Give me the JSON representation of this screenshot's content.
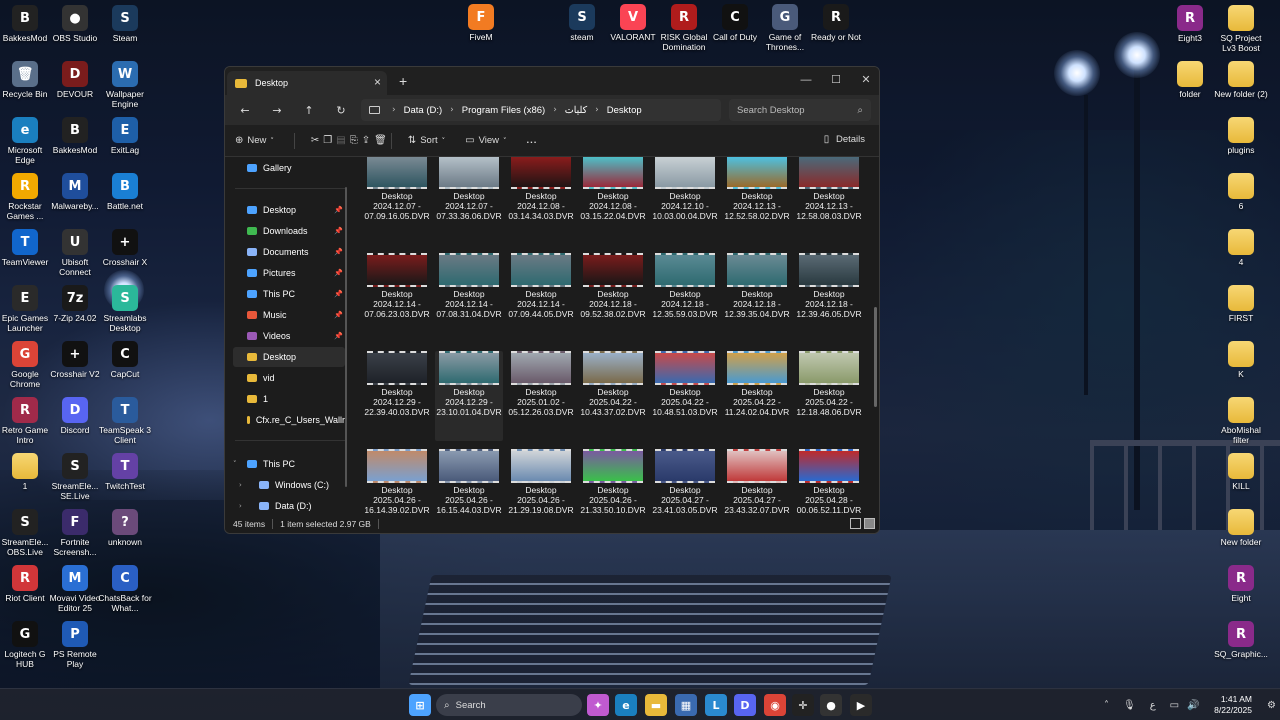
{
  "colors": {
    "window_bg": "#1c1c1c",
    "accent_blue": "#4da3ff",
    "folder_yellow": "#e8b93a"
  },
  "desktop_left": [
    {
      "label": "BakkesMod",
      "glyph": "B",
      "color": "#222222",
      "icon": "bakkesmod-icon"
    },
    {
      "label": "OBS Studio",
      "glyph": "●",
      "color": "#333333",
      "icon": "obs-icon"
    },
    {
      "label": "Steam",
      "glyph": "S",
      "color": "#1b3a5c",
      "icon": "steam-icon"
    },
    {
      "label": "Recycle Bin",
      "glyph": "🗑",
      "color": "#5a6f8a",
      "icon": "recycle-bin-icon"
    },
    {
      "label": "DEVOUR",
      "glyph": "D",
      "color": "#7a1c1c",
      "icon": "devour-icon"
    },
    {
      "label": "Wallpaper Engine",
      "glyph": "W",
      "color": "#2b6cb0",
      "icon": "wallpaper-engine-icon"
    },
    {
      "label": "Microsoft Edge",
      "glyph": "e",
      "color": "#1a7fbf",
      "icon": "edge-icon"
    },
    {
      "label": "BakkesMod",
      "glyph": "B",
      "color": "#222222",
      "icon": "bakkesmod-icon"
    },
    {
      "label": "ExitLag",
      "glyph": "E",
      "color": "#1e5fa8",
      "icon": "exitlag-icon"
    },
    {
      "label": "Rockstar Games ...",
      "glyph": "R",
      "color": "#f2a900",
      "icon": "rockstar-icon"
    },
    {
      "label": "Malwareby...",
      "glyph": "M",
      "color": "#1f4e9c",
      "icon": "malwarebytes-icon"
    },
    {
      "label": "Battle.net",
      "glyph": "B",
      "color": "#1a7fd4",
      "icon": "battlenet-icon"
    },
    {
      "label": "TeamViewer",
      "glyph": "T",
      "color": "#1166cc",
      "icon": "teamviewer-icon"
    },
    {
      "label": "Ubisoft Connect",
      "glyph": "U",
      "color": "#333333",
      "icon": "ubisoft-icon"
    },
    {
      "label": "Crosshair X",
      "glyph": "+",
      "color": "#111111",
      "icon": "crosshair-x-icon"
    },
    {
      "label": "Epic Games Launcher",
      "glyph": "E",
      "color": "#2a2a2a",
      "icon": "epic-games-icon"
    },
    {
      "label": "7-Zip 24.02",
      "glyph": "7z",
      "color": "#1a1a1a",
      "icon": "7zip-icon"
    },
    {
      "label": "Streamlabs Desktop",
      "glyph": "S",
      "color": "#2bb89a",
      "icon": "streamlabs-icon"
    },
    {
      "label": "Google Chrome",
      "glyph": "G",
      "color": "#db4437",
      "icon": "chrome-icon"
    },
    {
      "label": "Crosshair V2",
      "glyph": "+",
      "color": "#111111",
      "icon": "crosshair-v2-icon"
    },
    {
      "label": "CapCut",
      "glyph": "C",
      "color": "#111111",
      "icon": "capcut-icon"
    },
    {
      "label": "Retro Game Intro",
      "glyph": "R",
      "color": "#a02a4a",
      "icon": "retro-game-icon"
    },
    {
      "label": "Discord",
      "glyph": "D",
      "color": "#5865f2",
      "icon": "discord-icon"
    },
    {
      "label": "TeamSpeak 3 Client",
      "glyph": "T",
      "color": "#2a5b9c",
      "icon": "teamspeak-icon"
    },
    {
      "label": "1",
      "glyph": "",
      "color": "#e8b93a",
      "icon": "folder-icon"
    },
    {
      "label": "StreamEle... SE.Live",
      "glyph": "S",
      "color": "#222222",
      "icon": "streamelements-icon"
    },
    {
      "label": "TwitchTest",
      "glyph": "T",
      "color": "#6441a5",
      "icon": "twitchtest-icon"
    },
    {
      "label": "StreamEle... OBS.Live",
      "glyph": "S",
      "color": "#222222",
      "icon": "streamelements-obs-icon"
    },
    {
      "label": "Fortnite Screensh...",
      "glyph": "F",
      "color": "#3b2b6b",
      "icon": "fortnite-icon"
    },
    {
      "label": "unknown",
      "glyph": "?",
      "color": "#6b4a7a",
      "icon": "unknown-icon"
    },
    {
      "label": "Riot Client",
      "glyph": "R",
      "color": "#d13639",
      "icon": "riot-icon"
    },
    {
      "label": "Movavi Video Editor 25",
      "glyph": "M",
      "color": "#2a6fd4",
      "icon": "movavi-icon"
    },
    {
      "label": "ChatsBack for What...",
      "glyph": "C",
      "color": "#2a5fc4",
      "icon": "chatsback-icon"
    },
    {
      "label": "Logitech G HUB",
      "glyph": "G",
      "color": "#111111",
      "icon": "logitech-icon"
    },
    {
      "label": "PS Remote Play",
      "glyph": "P",
      "color": "#1f5ab5",
      "icon": "ps-remote-play-icon"
    }
  ],
  "desktop_top": [
    {
      "label": "FiveM",
      "glyph": "F",
      "color": "#f27b22",
      "icon": "fivem-icon"
    },
    {
      "label": "steam",
      "glyph": "S",
      "color": "#1b3a5c",
      "icon": "steam-icon"
    },
    {
      "label": "VALORANT",
      "glyph": "V",
      "color": "#fa4454",
      "icon": "valorant-icon"
    },
    {
      "label": "RISK Global Domination",
      "glyph": "R",
      "color": "#b01c1c",
      "icon": "risk-icon"
    },
    {
      "label": "Call of Duty",
      "glyph": "C",
      "color": "#111111",
      "icon": "call-of-duty-icon"
    },
    {
      "label": "Game of Thrones...",
      "glyph": "G",
      "color": "#4a5a7a",
      "icon": "game-of-thrones-icon"
    },
    {
      "label": "Ready or Not",
      "glyph": "R",
      "color": "#1a1a1a",
      "icon": "ready-or-not-icon"
    }
  ],
  "desktop_right": [
    {
      "label": "Eight3",
      "glyph": "R",
      "color": "#8a2a8a",
      "icon": "archive-icon"
    },
    {
      "label": "SQ Project Lv3 Boost",
      "glyph": "",
      "color": "#e8b93a",
      "icon": "folder-icon"
    },
    {
      "label": "folder",
      "glyph": "",
      "color": "#e8b93a",
      "icon": "folder-icon"
    },
    {
      "label": "New folder (2)",
      "glyph": "",
      "color": "#e8b93a",
      "icon": "folder-icon"
    },
    {
      "label": "plugins",
      "glyph": "",
      "color": "#e8b93a",
      "icon": "folder-icon"
    },
    {
      "label": "6",
      "glyph": "",
      "color": "#e8b93a",
      "icon": "folder-icon"
    },
    {
      "label": "4",
      "glyph": "",
      "color": "#e8b93a",
      "icon": "folder-icon"
    },
    {
      "label": "FIRST",
      "glyph": "",
      "color": "#e8b93a",
      "icon": "folder-icon"
    },
    {
      "label": "K",
      "glyph": "",
      "color": "#e8b93a",
      "icon": "folder-icon"
    },
    {
      "label": "AboMishal filter",
      "glyph": "",
      "color": "#e8b93a",
      "icon": "folder-icon"
    },
    {
      "label": "KILL",
      "glyph": "",
      "color": "#e8b93a",
      "icon": "folder-icon"
    },
    {
      "label": "New folder",
      "glyph": "",
      "color": "#e8b93a",
      "icon": "folder-icon"
    },
    {
      "label": "Eight",
      "glyph": "R",
      "color": "#8a2a8a",
      "icon": "archive-icon"
    },
    {
      "label": "SQ_Graphic...",
      "glyph": "R",
      "color": "#8a2a8a",
      "icon": "archive-icon"
    }
  ],
  "explorer": {
    "tab_title": "Desktop",
    "breadcrumb": [
      "Data (D:)",
      "Program Files (x86)",
      "كليات",
      "Desktop"
    ],
    "search_placeholder": "Search Desktop",
    "toolbar": {
      "new_label": "New",
      "sort_label": "Sort",
      "view_label": "View",
      "more_label": "...",
      "details_label": "Details"
    },
    "sidebar": [
      {
        "label": "Gallery",
        "icon": "gallery-icon",
        "color": "#4da3ff",
        "pinned": false,
        "chevron": ""
      },
      {
        "label": "Desktop",
        "icon": "desktop-icon",
        "color": "#4da3ff",
        "pinned": true,
        "chevron": ""
      },
      {
        "label": "Downloads",
        "icon": "downloads-icon",
        "color": "#3fb950",
        "pinned": true,
        "chevron": ""
      },
      {
        "label": "Documents",
        "icon": "documents-icon",
        "color": "#8ab4f8",
        "pinned": true,
        "chevron": ""
      },
      {
        "label": "Pictures",
        "icon": "pictures-icon",
        "color": "#4da3ff",
        "pinned": true,
        "chevron": ""
      },
      {
        "label": "This PC",
        "icon": "this-pc-icon",
        "color": "#4da3ff",
        "pinned": true,
        "chevron": ""
      },
      {
        "label": "Music",
        "icon": "music-icon",
        "color": "#e8573a",
        "pinned": true,
        "chevron": ""
      },
      {
        "label": "Videos",
        "icon": "videos-icon",
        "color": "#9b59b6",
        "pinned": true,
        "chevron": ""
      },
      {
        "label": "Desktop",
        "icon": "folder-icon",
        "color": "#e8b93a",
        "pinned": false,
        "chevron": ""
      },
      {
        "label": "vid",
        "icon": "folder-icon",
        "color": "#e8b93a",
        "pinned": false,
        "chevron": ""
      },
      {
        "label": "1",
        "icon": "folder-icon",
        "color": "#e8b93a",
        "pinned": false,
        "chevron": ""
      },
      {
        "label": "Cfx.re_C_Users_Wallr",
        "icon": "folder-icon",
        "color": "#e8b93a",
        "pinned": false,
        "chevron": ""
      },
      {
        "label": "This PC",
        "icon": "this-pc-icon",
        "color": "#4da3ff",
        "pinned": false,
        "chevron": "˅"
      },
      {
        "label": "Windows (C:)",
        "icon": "drive-icon",
        "color": "#8ab4f8",
        "pinned": false,
        "chevron": "›"
      },
      {
        "label": "Data (D:)",
        "icon": "drive-icon",
        "color": "#8ab4f8",
        "pinned": false,
        "chevron": "›"
      }
    ],
    "files": [
      {
        "name": "Desktop 2024.12.07 - 07.09.16.05.DVR",
        "thumb": "#2e5560",
        "thumb2": "#7a8a94"
      },
      {
        "name": "Desktop 2024.12.07 - 07.33.36.06.DVR",
        "thumb": "#6c7a86",
        "thumb2": "#b4c0c8"
      },
      {
        "name": "Desktop 2024.12.08 - 03.14.34.03.DVR",
        "thumb": "#201414",
        "thumb2": "#8a1c1c"
      },
      {
        "name": "Desktop 2024.12.08 - 03.15.22.04.DVR",
        "thumb": "#9a2a3a",
        "thumb2": "#4ec0c8"
      },
      {
        "name": "Desktop 2024.12.10 - 10.03.00.04.DVR",
        "thumb": "#8a9aa4",
        "thumb2": "#c8d0d4"
      },
      {
        "name": "Desktop 2024.12.13 - 12.52.58.02.DVR",
        "thumb": "#9a6a2a",
        "thumb2": "#4ec0e0"
      },
      {
        "name": "Desktop 2024.12.13 - 12.58.08.03.DVR",
        "thumb": "#8a2a2a",
        "thumb2": "#4a6a7a"
      },
      {
        "name": "Desktop 2024.12.14 - 07.06.23.03.DVR",
        "thumb": "#1a1818",
        "thumb2": "#7a1c1c"
      },
      {
        "name": "Desktop 2024.12.14 - 07.08.31.04.DVR",
        "thumb": "#2e6a70",
        "thumb2": "#6a7a84"
      },
      {
        "name": "Desktop 2024.12.14 - 07.09.44.05.DVR",
        "thumb": "#2e6a70",
        "thumb2": "#6a7a84"
      },
      {
        "name": "Desktop 2024.12.18 - 09.52.38.02.DVR",
        "thumb": "#1a1616",
        "thumb2": "#7a1c1c"
      },
      {
        "name": "Desktop 2024.12.18 - 12.35.59.03.DVR",
        "thumb": "#2e6a70",
        "thumb2": "#5a8a94"
      },
      {
        "name": "Desktop 2024.12.18 - 12.39.35.04.DVR",
        "thumb": "#2e6a70",
        "thumb2": "#6a8a94"
      },
      {
        "name": "Desktop 2024.12.18 - 12.39.46.05.DVR",
        "thumb": "#2a3a40",
        "thumb2": "#5a6a74"
      },
      {
        "name": "Desktop 2024.12.29 - 22.39.40.03.DVR",
        "thumb": "#1e2228",
        "thumb2": "#3a4048"
      },
      {
        "name": "Desktop 2024.12.29 - 23.10.01.04.DVR",
        "thumb": "#2e6a70",
        "thumb2": "#8a9aa4"
      },
      {
        "name": "Desktop 2025.01.02 - 05.12.26.03.DVR",
        "thumb": "#6a5a6a",
        "thumb2": "#a0a8b0"
      },
      {
        "name": "Desktop 2025.04.22 - 10.43.37.02.DVR",
        "thumb": "#7a6a4a",
        "thumb2": "#9ab0c8"
      },
      {
        "name": "Desktop 2025.04.22 - 10.48.51.03.DVR",
        "thumb": "#3a6ab0",
        "thumb2": "#c84a4a"
      },
      {
        "name": "Desktop 2025.04.22 - 11.24.02.04.DVR",
        "thumb": "#4a9ad0",
        "thumb2": "#d0a04a"
      },
      {
        "name": "Desktop 2025.04.22 - 12.18.48.06.DVR",
        "thumb": "#8a9a6a",
        "thumb2": "#c0c8b0"
      },
      {
        "name": "Desktop 2025.04.26 - 16.14.39.02.DVR",
        "thumb": "#7aa0d0",
        "thumb2": "#c08a6a"
      },
      {
        "name": "Desktop 2025.04.26 - 16.15.44.03.DVR",
        "thumb": "#4a5a7a",
        "thumb2": "#8a9ab0"
      },
      {
        "name": "Desktop 2025.04.26 - 21.29.19.08.DVR",
        "thumb": "#6a8ab0",
        "thumb2": "#d0d4d8"
      },
      {
        "name": "Desktop 2025.04.26 - 21.33.50.10.DVR",
        "thumb": "#3ac04a",
        "thumb2": "#7a5aa0"
      },
      {
        "name": "Desktop 2025.04.27 - 23.41.03.05.DVR",
        "thumb": "#2a3a6a",
        "thumb2": "#4a5a8a"
      },
      {
        "name": "Desktop 2025.04.27 - 23.43.32.07.DVR",
        "thumb": "#c03a3a",
        "thumb2": "#e0c0c0"
      },
      {
        "name": "Desktop 2025.04.28 - 00.06.52.11.DVR",
        "thumb": "#2a6ad0",
        "thumb2": "#c02a2a"
      }
    ],
    "selected_index": 15,
    "status": {
      "count": "45 items",
      "selection": "1 item selected  2.97 GB"
    }
  },
  "taskbar": {
    "search_label": "Search",
    "apps": [
      {
        "name": "start-button",
        "glyph": "⊞",
        "color": "#4da3ff"
      },
      {
        "name": "copilot-icon",
        "glyph": "✦",
        "color": "#c05ad0"
      },
      {
        "name": "edge-icon",
        "glyph": "e",
        "color": "#1a7fbf"
      },
      {
        "name": "file-explorer-icon",
        "glyph": "▬",
        "color": "#e8b93a"
      },
      {
        "name": "store-icon",
        "glyph": "▦",
        "color": "#3a6ab0"
      },
      {
        "name": "ltx-icon",
        "glyph": "L",
        "color": "#2a8ad0"
      },
      {
        "name": "discord-icon",
        "glyph": "D",
        "color": "#5865f2"
      },
      {
        "name": "chrome-icon",
        "glyph": "◉",
        "color": "#db4437"
      },
      {
        "name": "crosshair-icon",
        "glyph": "✛",
        "color": "#222222"
      },
      {
        "name": "obs-icon",
        "glyph": "●",
        "color": "#333333"
      },
      {
        "name": "media-player-icon",
        "glyph": "▶",
        "color": "#2a2a2a"
      }
    ],
    "tray_lang": "ع",
    "time": "1:41 AM",
    "date": "8/22/2025"
  }
}
